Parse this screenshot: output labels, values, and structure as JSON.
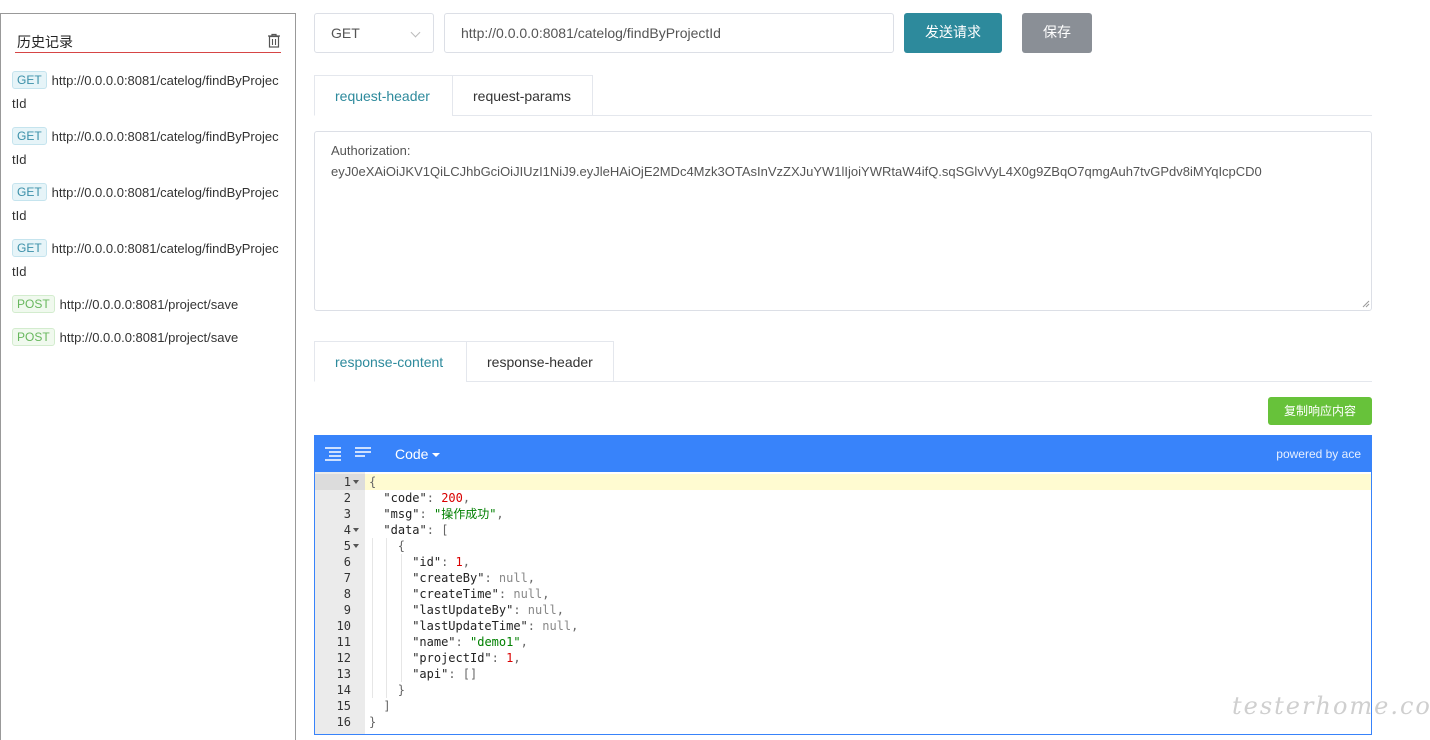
{
  "sidebar": {
    "title": "历史记录",
    "history": [
      {
        "method": "GET",
        "url": "http://0.0.0.0:8081/catelog/findByProjectId"
      },
      {
        "method": "GET",
        "url": "http://0.0.0.0:8081/catelog/findByProjectId"
      },
      {
        "method": "GET",
        "url": "http://0.0.0.0:8081/catelog/findByProjectId"
      },
      {
        "method": "GET",
        "url": "http://0.0.0.0:8081/catelog/findByProjectId"
      },
      {
        "method": "POST",
        "url": "http://0.0.0.0:8081/project/save"
      },
      {
        "method": "POST",
        "url": "http://0.0.0.0:8081/project/save"
      }
    ]
  },
  "toolbar": {
    "method": "GET",
    "url": "http://0.0.0.0:8081/catelog/findByProjectId",
    "send_label": "发送请求",
    "save_label": "保存"
  },
  "request_tabs": [
    "request-header",
    "request-params"
  ],
  "request_header_text": "Authorization:\neyJ0eXAiOiJKV1QiLCJhbGciOiJIUzI1NiJ9.eyJleHAiOjE2MDc4Mzk3OTAsInVzZXJuYW1lIjoiYWRtaW4ifQ.sqSGlvVyL4X0g9ZBqO7qmgAuh7tvGPdv8iMYqIcpCD0",
  "response_tabs": [
    "response-content",
    "response-header"
  ],
  "copy_label": "复制响应内容",
  "editor": {
    "mode_label": "Code",
    "powered": "powered by ace",
    "lines": [
      {
        "n": 1,
        "fold": true,
        "indent": 0,
        "tokens": [
          [
            "p",
            "{"
          ]
        ]
      },
      {
        "n": 2,
        "fold": false,
        "indent": 1,
        "tokens": [
          [
            "k",
            "\"code\""
          ],
          [
            "p",
            ": "
          ],
          [
            "n",
            "200"
          ],
          [
            "p",
            ","
          ]
        ]
      },
      {
        "n": 3,
        "fold": false,
        "indent": 1,
        "tokens": [
          [
            "k",
            "\"msg\""
          ],
          [
            "p",
            ": "
          ],
          [
            "s",
            "\"操作成功\""
          ],
          [
            "p",
            ","
          ]
        ]
      },
      {
        "n": 4,
        "fold": true,
        "indent": 1,
        "tokens": [
          [
            "k",
            "\"data\""
          ],
          [
            "p",
            ": ["
          ]
        ]
      },
      {
        "n": 5,
        "fold": true,
        "indent": 2,
        "tokens": [
          [
            "p",
            "{"
          ]
        ]
      },
      {
        "n": 6,
        "fold": false,
        "indent": 3,
        "tokens": [
          [
            "k",
            "\"id\""
          ],
          [
            "p",
            ": "
          ],
          [
            "n",
            "1"
          ],
          [
            "p",
            ","
          ]
        ]
      },
      {
        "n": 7,
        "fold": false,
        "indent": 3,
        "tokens": [
          [
            "k",
            "\"createBy\""
          ],
          [
            "p",
            ": "
          ],
          [
            "nl",
            "null"
          ],
          [
            "p",
            ","
          ]
        ]
      },
      {
        "n": 8,
        "fold": false,
        "indent": 3,
        "tokens": [
          [
            "k",
            "\"createTime\""
          ],
          [
            "p",
            ": "
          ],
          [
            "nl",
            "null"
          ],
          [
            "p",
            ","
          ]
        ]
      },
      {
        "n": 9,
        "fold": false,
        "indent": 3,
        "tokens": [
          [
            "k",
            "\"lastUpdateBy\""
          ],
          [
            "p",
            ": "
          ],
          [
            "nl",
            "null"
          ],
          [
            "p",
            ","
          ]
        ]
      },
      {
        "n": 10,
        "fold": false,
        "indent": 3,
        "tokens": [
          [
            "k",
            "\"lastUpdateTime\""
          ],
          [
            "p",
            ": "
          ],
          [
            "nl",
            "null"
          ],
          [
            "p",
            ","
          ]
        ]
      },
      {
        "n": 11,
        "fold": false,
        "indent": 3,
        "tokens": [
          [
            "k",
            "\"name\""
          ],
          [
            "p",
            ": "
          ],
          [
            "s",
            "\"demo1\""
          ],
          [
            "p",
            ","
          ]
        ]
      },
      {
        "n": 12,
        "fold": false,
        "indent": 3,
        "tokens": [
          [
            "k",
            "\"projectId\""
          ],
          [
            "p",
            ": "
          ],
          [
            "n",
            "1"
          ],
          [
            "p",
            ","
          ]
        ]
      },
      {
        "n": 13,
        "fold": false,
        "indent": 3,
        "tokens": [
          [
            "k",
            "\"api\""
          ],
          [
            "p",
            ": []"
          ]
        ]
      },
      {
        "n": 14,
        "fold": false,
        "indent": 2,
        "tokens": [
          [
            "p",
            "}"
          ]
        ]
      },
      {
        "n": 15,
        "fold": false,
        "indent": 1,
        "tokens": [
          [
            "p",
            "]"
          ]
        ]
      },
      {
        "n": 16,
        "fold": false,
        "indent": 0,
        "tokens": [
          [
            "p",
            "}"
          ]
        ]
      }
    ]
  },
  "watermark": "testerhome.com",
  "colors": {
    "accent": "#2d8a9c",
    "editor_bar": "#3883fa",
    "copy_button": "#67c23a",
    "save_button": "#8a8f96",
    "sidebar_underline": "#d64545"
  }
}
